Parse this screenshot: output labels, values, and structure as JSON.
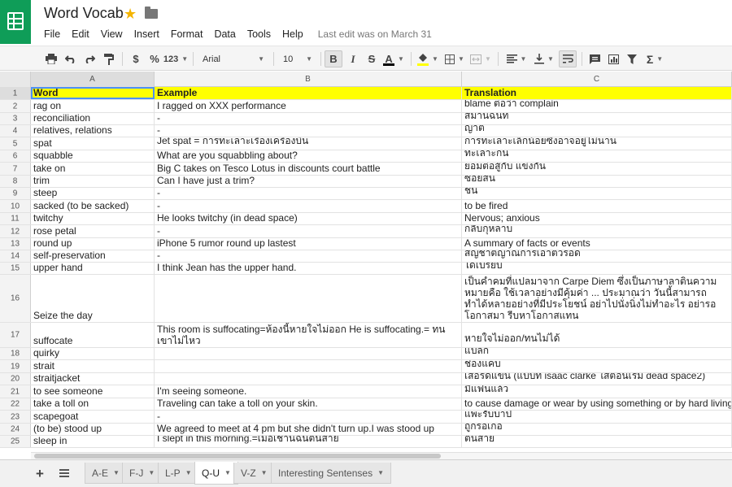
{
  "doc": {
    "title": "Word Vocab",
    "last_edit": "Last edit was on March 31"
  },
  "menu": [
    "File",
    "Edit",
    "View",
    "Insert",
    "Format",
    "Data",
    "Tools",
    "Help"
  ],
  "toolbar": {
    "currency": "$",
    "percent": "%",
    "number_format": "123",
    "font": "Arial",
    "font_size": "10",
    "bold": "B",
    "italic": "I",
    "strike": "S",
    "text_color": "A",
    "sum": "Σ"
  },
  "columns": [
    "A",
    "B",
    "C"
  ],
  "rows": [
    {
      "n": "1",
      "a": "Word",
      "b": "Example",
      "c": "Translation"
    },
    {
      "n": "2",
      "a": "rag on",
      "b": "I ragged on XXX performance",
      "c": "blame ต่อว่า complain"
    },
    {
      "n": "3",
      "a": "reconciliation",
      "b": "-",
      "c": "สมานฉันท์"
    },
    {
      "n": "4",
      "a": "relatives, relations",
      "b": "-",
      "c": "ญาติ"
    },
    {
      "n": "5",
      "a": "spat",
      "b": "Jet spat = การทะเลาะเรื่องเครื่องบิน",
      "c": "การทะเลาะเล็กน้อยซึ่งอาจอยู่ไม่นาน"
    },
    {
      "n": "6",
      "a": "squabble",
      "b": "What are you squabbling about?",
      "c": "ทะเลาะกัน"
    },
    {
      "n": "7",
      "a": "take on",
      "b": "Big C takes on Tesco Lotus in discounts court battle",
      "c": "ยอมต่อสู้กับ แข่งกัน"
    },
    {
      "n": "8",
      "a": "trim",
      "b": "Can I have just a trim?",
      "c": "ซอยสั้น"
    },
    {
      "n": "9",
      "a": "steep",
      "b": "-",
      "c": "ชัน"
    },
    {
      "n": "10",
      "a": "sacked (to be sacked)",
      "b": "-",
      "c": "to be fired"
    },
    {
      "n": "11",
      "a": "twitchy",
      "b": "He looks twitchy (in dead space)",
      "c": "Nervous; anxious"
    },
    {
      "n": "12",
      "a": "rose petal",
      "b": "-",
      "c": "กลีบกุหลาบ"
    },
    {
      "n": "13",
      "a": "round up",
      "b": "iPhone 5 rumor round up lastest",
      "c": "A summary of facts or events"
    },
    {
      "n": "14",
      "a": "self-preservation",
      "b": "-",
      "c": "สัญชาตญาณการเอาตัวรอด"
    },
    {
      "n": "15",
      "a": "upper hand",
      "b": "I think Jean has the upper hand.",
      "c": "ได้เปรียบ"
    },
    {
      "n": "16",
      "a": "Seize the day",
      "b": "",
      "c": "เป็นคำคมที่แปลมาจาก Carpe Diem ซึ่งเป็นภาษาลาตินความหมายคือ ใช้เวลาอย่างมีคุ้มค่า ... ประมาณว่า วันนี้สามารถทำได้หลายอย่างที่มีประโยชน์ อย่าไปนั่งนิ่งไม่ทำอะไร อย่ารอโอกาสมา รีบหาโอกาสแทน"
    },
    {
      "n": "17",
      "a": "suffocate",
      "b": "This room is suffocating=ห้องนี้หายใจไม่ออก He is suffocating.= ทนเขาไม่ไหว",
      "c": "หายใจไม่ออก/ทนไม่ได้"
    },
    {
      "n": "18",
      "a": "quirky",
      "b": "",
      "c": "แปลก"
    },
    {
      "n": "19",
      "a": "strait",
      "b": "",
      "c": "ช่องแคบ"
    },
    {
      "n": "20",
      "a": "straitjacket",
      "b": "",
      "c": "เสื้อรัดแขน (แบบที่ isaac clarke ใส่ตอนเริ่ม dead space2)"
    },
    {
      "n": "21",
      "a": "to see someone",
      "b": "I'm seeing someone.",
      "c": "มีแฟนแล้ว"
    },
    {
      "n": "22",
      "a": "take a toll on",
      "b": "Traveling can take a toll on your skin.",
      "c": "to cause damage or wear by using something or by hard living."
    },
    {
      "n": "23",
      "a": "scapegoat",
      "b": "-",
      "c": "แพะรับบาป"
    },
    {
      "n": "24",
      "a": "(to be) stood up",
      "b": "We agreed to meet at 4 pm but she didn't turn up.I was stood up",
      "c": "ถูกรอเก้อ"
    },
    {
      "n": "25",
      "a": "sleep in",
      "b": "I slept in this morning.=เมื่อเช้านี้ฉันตื่นสาย",
      "c": "ตื่นสาย"
    }
  ],
  "sheets": [
    {
      "label": "A-E",
      "active": false
    },
    {
      "label": "F-J",
      "active": false
    },
    {
      "label": "L-P",
      "active": false
    },
    {
      "label": "Q-U",
      "active": true
    },
    {
      "label": "V-Z",
      "active": false
    },
    {
      "label": "Interesting Sentenses",
      "active": false
    }
  ],
  "colors": {
    "brand": "#0f9d58",
    "header_fill": "#ffff00",
    "star": "#f4b400",
    "selection": "#4d90fe"
  },
  "icons": {
    "logo": "sheets-logo-icon",
    "star": "star-icon",
    "folder": "folder-icon"
  }
}
